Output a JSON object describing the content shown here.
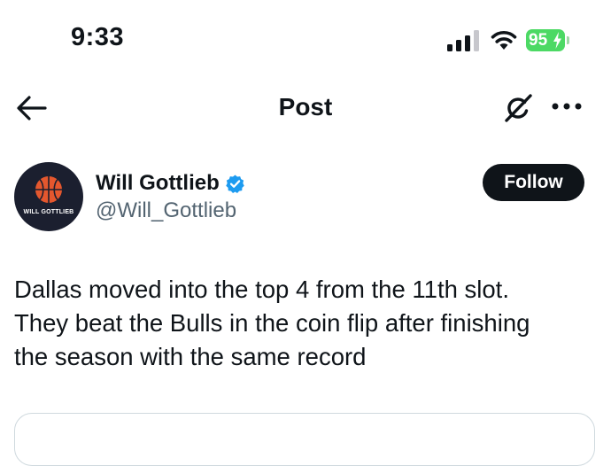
{
  "status_bar": {
    "time": "9:33",
    "battery_level": "95",
    "icons": [
      "cellular-signal-icon",
      "wifi-icon",
      "battery-charging-icon"
    ]
  },
  "header": {
    "title": "Post",
    "icons": [
      "back-arrow-icon",
      "grok-icon",
      "more-icon"
    ]
  },
  "author": {
    "name": "Will Gottlieb",
    "handle": "@Will_Gottlieb",
    "avatar_text": "WILL GOTTLIEB",
    "verified": true,
    "follow_label": "Follow"
  },
  "post": {
    "lines": [
      "Dallas moved into the top 4 from the 11th slot.",
      "They beat the Bulls in the coin flip after finishing",
      "the season with the same record"
    ]
  },
  "colors": {
    "text": "#0f1419",
    "secondary_text": "#536471",
    "verified": "#1d9bf0",
    "battery": "#4cd964",
    "follow_bg": "#0f1419",
    "avatar_bg": "#1b1f2f",
    "avatar_ball": "#e4572e"
  }
}
